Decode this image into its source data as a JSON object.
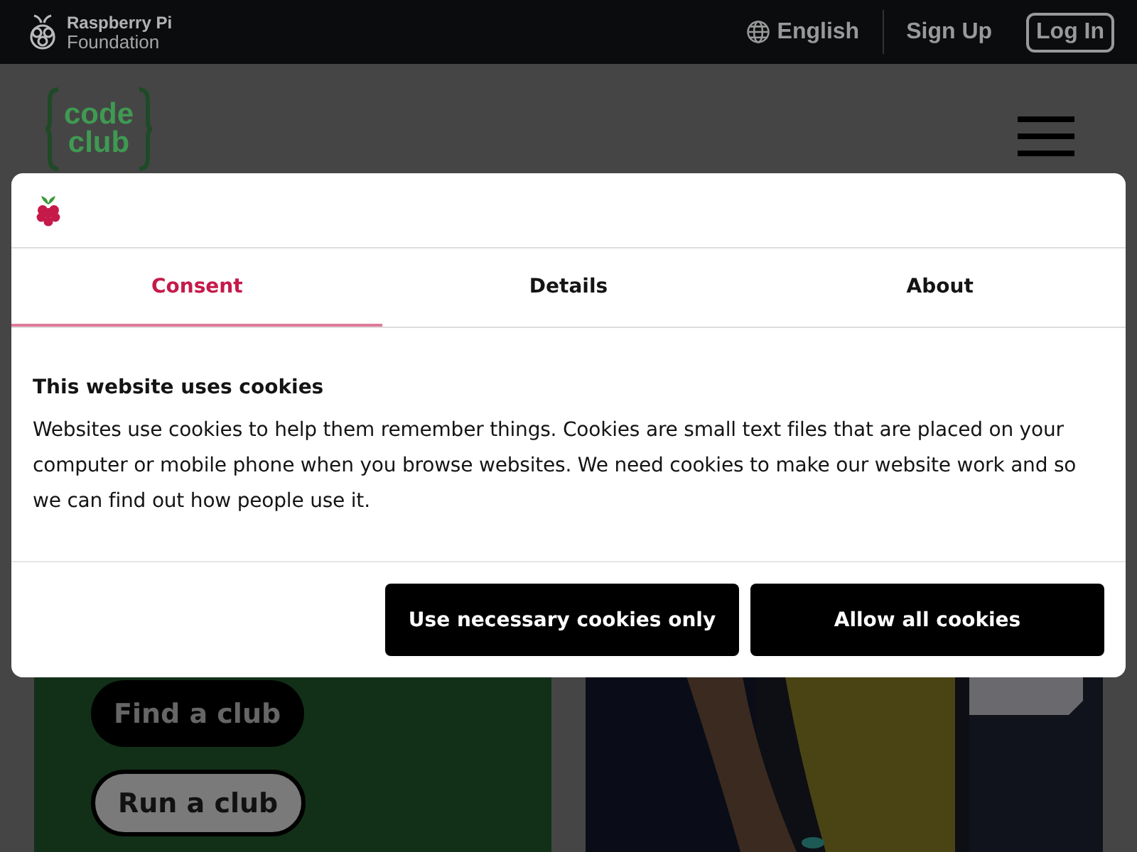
{
  "top_bar": {
    "brand": [
      "Raspberry Pi",
      "Foundation"
    ],
    "language": "English",
    "links": [
      {
        "label": "Sign Up",
        "kind": "link"
      },
      {
        "label": "Log In",
        "kind": "outlined"
      }
    ]
  },
  "site_header": {
    "logo": [
      "code",
      "club"
    ]
  },
  "hero": {
    "buttons": [
      {
        "label": "Find a club",
        "kind": "filled"
      },
      {
        "label": "Run a club",
        "kind": "outlined"
      }
    ]
  },
  "cookie_dialog": {
    "tabs": [
      {
        "label": "Consent",
        "selected": true
      },
      {
        "label": "Details",
        "selected": false
      },
      {
        "label": "About",
        "selected": false
      }
    ],
    "title": "This website uses cookies",
    "text": "Websites use cookies to help them remember things. Cookies are small text files that are placed on your computer or mobile phone when you browse websites. We need cookies to make our website work and so we can find out how people use it.",
    "buttons": [
      "Use necessary cookies only",
      "Allow all cookies"
    ]
  }
}
